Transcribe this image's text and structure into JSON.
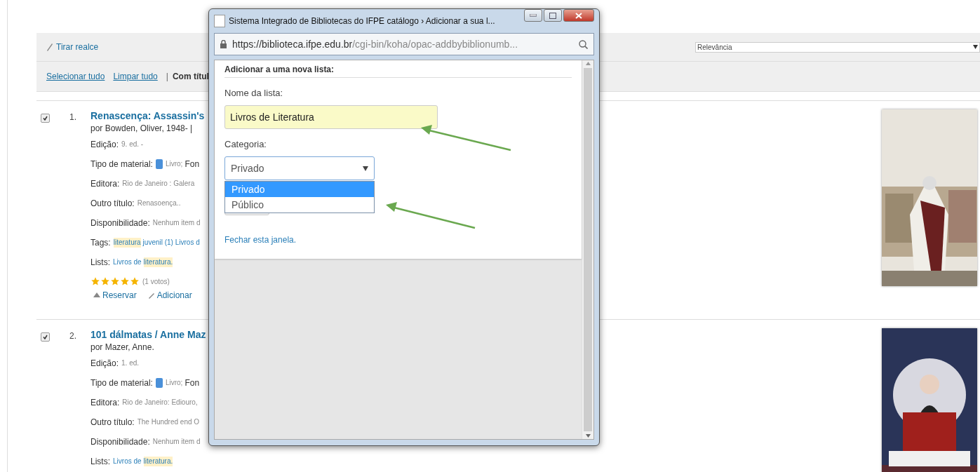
{
  "toolbar": {
    "clear_highlight": "Tirar realce",
    "sort": {
      "value": "Relevância"
    }
  },
  "selection_bar": {
    "select_all": "Selecionar tudo",
    "clear_all": "Limpar tudo",
    "separator": "|",
    "with_selected": "Com títul"
  },
  "results": [
    {
      "checked": true,
      "number": "1.",
      "title": "Renascença: Assassin's",
      "byline": "por Bowden, Oliver, 1948- |",
      "fields": [
        {
          "kind": "text",
          "label": "Edição:",
          "parts": [
            {
              "text": "9. ed. -",
              "highlight": false
            }
          ]
        },
        {
          "kind": "material",
          "label": "Tipo de material:",
          "parts": [
            {
              "text": "Livro;",
              "highlight": false
            }
          ],
          "extra": "Fon"
        },
        {
          "kind": "text",
          "label": "Editora:",
          "parts": [
            {
              "text": "Rio de Janeiro : Galera",
              "highlight": false
            }
          ]
        },
        {
          "kind": "text",
          "label": "Outro título:",
          "parts": [
            {
              "text": "Renasoença..",
              "highlight": false
            }
          ]
        },
        {
          "kind": "text",
          "label": "Disponibilidade:",
          "parts": [
            {
              "text": "Nenhum item d",
              "highlight": false
            }
          ]
        },
        {
          "kind": "link",
          "label": "Tags:",
          "parts": [
            {
              "text": "literatura",
              "highlight": true
            },
            {
              "text": "juvenil (1) Livros d",
              "highlight": false
            }
          ]
        },
        {
          "kind": "link",
          "label": "Lists:",
          "parts": [
            {
              "text": "Livros de",
              "highlight": false
            },
            {
              "text": "literatura.",
              "highlight": true
            }
          ]
        }
      ],
      "stars": 5,
      "votes": "(1 votos)",
      "actions": [
        "Reservar",
        "Adicionar"
      ]
    },
    {
      "checked": true,
      "number": "2.",
      "title": "101 dálmatas / Anne Maz",
      "byline": "por Mazer, Anne.",
      "fields": [
        {
          "kind": "text",
          "label": "Edição:",
          "parts": [
            {
              "text": "1. ed.",
              "highlight": false
            }
          ]
        },
        {
          "kind": "material",
          "label": "Tipo de material:",
          "parts": [
            {
              "text": "Livro;",
              "highlight": false
            }
          ],
          "extra": "Fon"
        },
        {
          "kind": "text",
          "label": "Editora:",
          "parts": [
            {
              "text": "Rio de Janeiro: Ediouro,",
              "highlight": false
            }
          ]
        },
        {
          "kind": "text",
          "label": "Outro título:",
          "parts": [
            {
              "text": "The Hundred end O",
              "highlight": false
            }
          ]
        },
        {
          "kind": "text",
          "label": "Disponibilidade:",
          "parts": [
            {
              "text": "Nenhum item d",
              "highlight": false
            }
          ]
        },
        {
          "kind": "link",
          "label": "Lists:",
          "parts": [
            {
              "text": "Livros de",
              "highlight": false
            },
            {
              "text": "literatura.",
              "highlight": true
            }
          ]
        }
      ]
    }
  ],
  "popup": {
    "title": "Sistema Integrado de Bibliotecas do IFPE catálogo › Adicionar a sua l...",
    "url_host": "https://biblioteca.ifpe.edu.br",
    "url_path": "/cgi-bin/koha/opac-addbybiblionumb...",
    "heading": "Adicionar a uma nova lista:",
    "name_label": "Nome da lista:",
    "name_value": "Livros de Literatura",
    "name_autofilled": true,
    "category_label": "Categoria:",
    "category": {
      "value": "Privado",
      "expanded": true,
      "options": [
        {
          "label": "Privado",
          "selected": true
        },
        {
          "label": "Público",
          "selected": false
        }
      ]
    },
    "close_link": "Fechar esta janela."
  }
}
